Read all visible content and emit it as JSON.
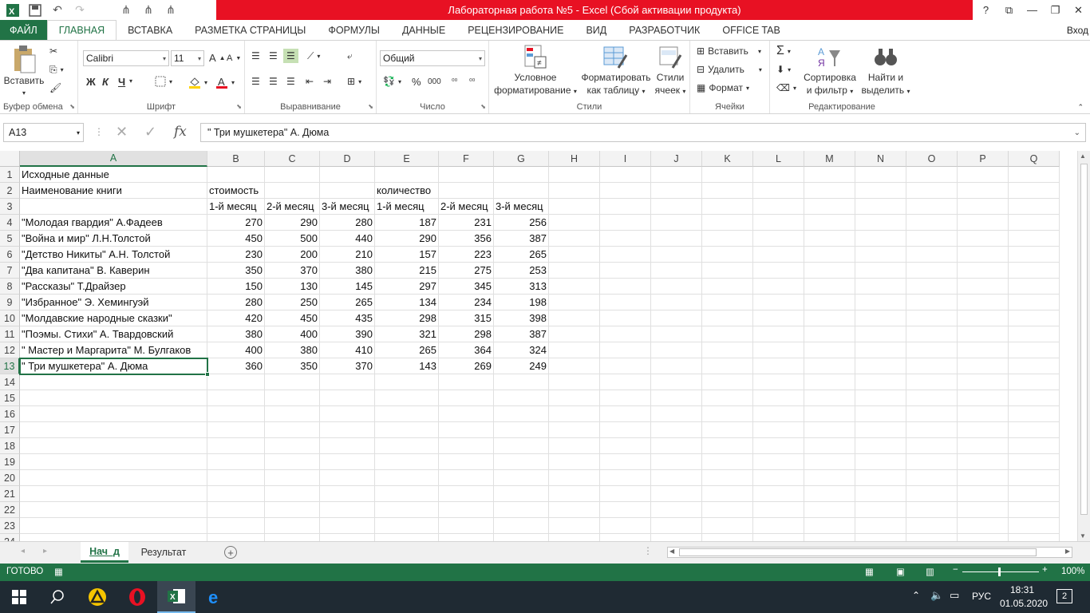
{
  "window": {
    "title": "Лабораторная работа №5 -  Excel (Сбой активации продукта)",
    "help": "?",
    "sign_in": "Вход"
  },
  "ribbon_tabs": [
    "ФАЙЛ",
    "ГЛАВНАЯ",
    "ВСТАВКА",
    "РАЗМЕТКА СТРАНИЦЫ",
    "ФОРМУЛЫ",
    "ДАННЫЕ",
    "РЕЦЕНЗИРОВАНИЕ",
    "ВИД",
    "РАЗРАБОТЧИК",
    "OFFICE TAB"
  ],
  "ribbon": {
    "clipboard": {
      "paste": "Вставить",
      "label": "Буфер обмена"
    },
    "font": {
      "name": "Calibri",
      "size": "11",
      "bold": "Ж",
      "italic": "К",
      "underline": "Ч",
      "label": "Шрифт"
    },
    "alignment": {
      "label": "Выравнивание"
    },
    "number": {
      "format": "Общий",
      "percent": "%",
      "thousands": "000",
      "label": "Число"
    },
    "styles": {
      "conditional_line1": "Условное",
      "conditional_line2": "форматирование",
      "table_line1": "Форматировать",
      "table_line2": "как таблицу",
      "cell_line1": "Стили",
      "cell_line2": "ячеек",
      "label": "Стили"
    },
    "cells": {
      "insert": "Вставить",
      "delete": "Удалить",
      "format": "Формат",
      "label": "Ячейки"
    },
    "editing": {
      "sort_line1": "Сортировка",
      "sort_line2": "и фильтр",
      "find_line1": "Найти и",
      "find_line2": "выделить",
      "label": "Редактирование"
    }
  },
  "formula_bar": {
    "name_box": "A13",
    "fx": "fx",
    "content": "\" Три мушкетера\" А. Дюма"
  },
  "grid": {
    "columns": [
      "A",
      "B",
      "C",
      "D",
      "E",
      "F",
      "G",
      "H",
      "I",
      "J",
      "K",
      "L",
      "M",
      "N",
      "O",
      "P",
      "Q"
    ],
    "row_numbers": [
      "1",
      "2",
      "3",
      "4",
      "5",
      "6",
      "7",
      "8",
      "9",
      "10",
      "11",
      "12",
      "13",
      "14",
      "15",
      "16",
      "17",
      "18",
      "19",
      "20",
      "21",
      "22",
      "23",
      "24"
    ],
    "header_rows": {
      "r1": "Исходные данные",
      "r2_a": "Наименование книги",
      "r2_b": "стоимость",
      "r2_e": "количество",
      "r3": [
        "1-й месяц",
        "2-й месяц",
        "3-й месяц",
        "1-й месяц",
        "2-й месяц",
        "3-й месяц"
      ]
    },
    "data_rows": [
      {
        "book": "\"Молодая гвардия\" А.Фадеев",
        "values": [
          "270",
          "290",
          "280",
          "187",
          "231",
          "256"
        ]
      },
      {
        "book": "\"Война и мир\" Л.Н.Толстой",
        "values": [
          "450",
          "500",
          "440",
          "290",
          "356",
          "387"
        ]
      },
      {
        "book": "\"Детство Никиты\" А.Н. Толстой",
        "values": [
          "230",
          "200",
          "210",
          "157",
          "223",
          "265"
        ]
      },
      {
        "book": "\"Два капитана\" В. Каверин",
        "values": [
          "350",
          "370",
          "380",
          "215",
          "275",
          "253"
        ]
      },
      {
        "book": "\"Рассказы\" Т.Драйзер",
        "values": [
          "150",
          "130",
          "145",
          "297",
          "345",
          "313"
        ]
      },
      {
        "book": "\"Избранное\" Э. Хемингуэй",
        "values": [
          "280",
          "250",
          "265",
          "134",
          "234",
          "198"
        ]
      },
      {
        "book": "\"Молдавские народные сказки\"",
        "values": [
          "420",
          "450",
          "435",
          "298",
          "315",
          "398"
        ]
      },
      {
        "book": "\"Поэмы. Стихи\" А. Твардовский",
        "values": [
          "380",
          "400",
          "390",
          "321",
          "298",
          "387"
        ]
      },
      {
        "book": "\" Мастер и Маргарита\" М. Булгаков",
        "values": [
          "400",
          "380",
          "410",
          "265",
          "364",
          "324"
        ]
      },
      {
        "book": "\" Три мушкетера\" А. Дюма",
        "values": [
          "360",
          "350",
          "370",
          "143",
          "269",
          "249"
        ]
      }
    ]
  },
  "sheets": {
    "tab1": "Нач_д",
    "tab2": "Результат"
  },
  "status": {
    "ready": "ГОТОВО",
    "zoom": "100%"
  },
  "taskbar": {
    "time": "18:31",
    "date": "01.05.2020",
    "lang": "РУС",
    "notifications": "2"
  }
}
